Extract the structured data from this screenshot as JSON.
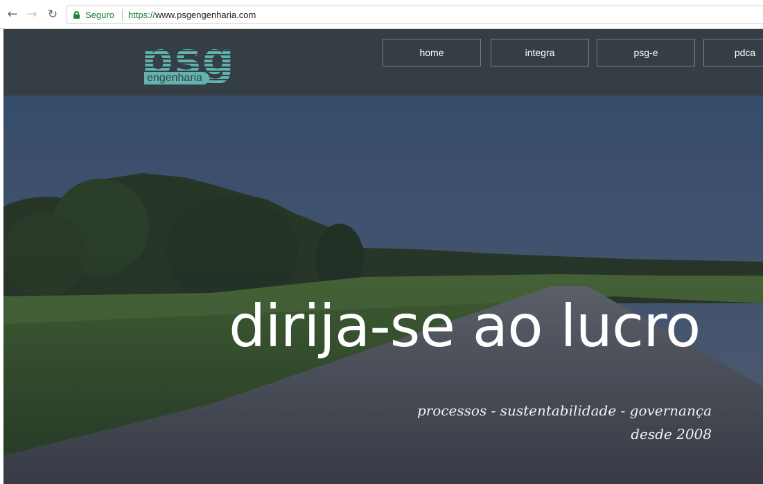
{
  "browser": {
    "back_icon": "back-arrow-icon",
    "forward_icon": "forward-arrow-icon",
    "reload_icon": "reload-icon",
    "secure_label": "Seguro",
    "url_scheme": "https://",
    "url_host": "www.psgengenharia.com",
    "secure_color": "#188038"
  },
  "header": {
    "logo_text": "psg",
    "logo_subtext": "engenharia",
    "background_color": "#363e45",
    "logo_color": "#5fb3ad",
    "menu": [
      {
        "label": "home"
      },
      {
        "label": "integra"
      },
      {
        "label": "psg-e"
      },
      {
        "label": "pdca"
      }
    ]
  },
  "hero": {
    "headline": "dirija-se ao lucro",
    "tagline": "processos - sustentabilidade - governança",
    "since": "desde 2008"
  }
}
